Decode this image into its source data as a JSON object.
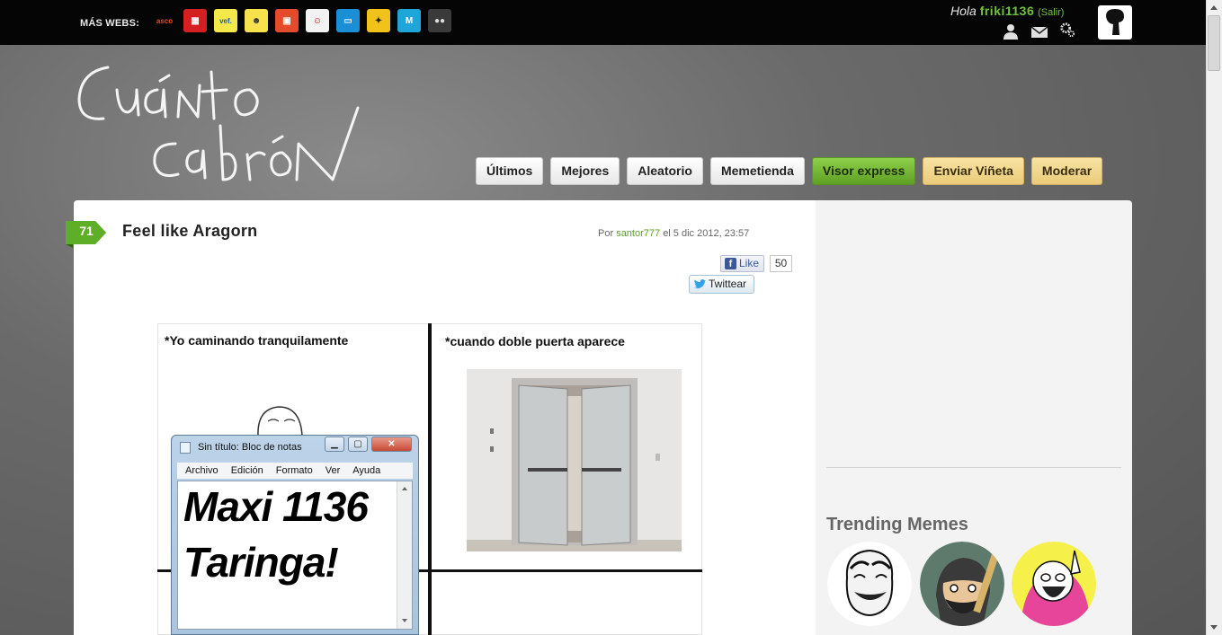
{
  "topbar": {
    "mas_webs_label": "MÁS WEBS:",
    "sites": [
      {
        "icon": "asco-de-vida-icon",
        "glyph": "asco",
        "bg": "#050505",
        "color": "#e84c1a"
      },
      {
        "icon": "calendar-site-icon",
        "glyph": "▦",
        "bg": "#d42020",
        "color": "#fff"
      },
      {
        "icon": "vef-icon",
        "glyph": "vef.",
        "bg": "#f5e84a",
        "color": "#1a5bb5"
      },
      {
        "icon": "banana-icon",
        "glyph": "☻",
        "bg": "#f7e24d",
        "color": "#333"
      },
      {
        "icon": "picture-site-icon",
        "glyph": "▣",
        "bg": "#e34b2a",
        "color": "#fff"
      },
      {
        "icon": "meme-face-icon",
        "glyph": "☺",
        "bg": "#f2f2f2",
        "color": "#c00"
      },
      {
        "icon": "tv-site-icon",
        "glyph": "▭",
        "bg": "#1a8fd6",
        "color": "#fff"
      },
      {
        "icon": "cat-site-icon",
        "glyph": "✦",
        "bg": "#f1c21a",
        "color": "#222"
      },
      {
        "icon": "m-site-icon",
        "glyph": "M",
        "bg": "#1ea6d8",
        "color": "#fff"
      },
      {
        "icon": "eyes-site-icon",
        "glyph": "●●",
        "bg": "#3a3a3a",
        "color": "#ddd"
      }
    ],
    "hola": "Hola",
    "username": "friki1136",
    "salir": "(Salir)"
  },
  "nav": {
    "items": [
      {
        "label": "Últimos",
        "style": "white"
      },
      {
        "label": "Mejores",
        "style": "white"
      },
      {
        "label": "Aleatorio",
        "style": "white"
      },
      {
        "label": "Memetienda",
        "style": "white"
      },
      {
        "label": "Visor express",
        "style": "green"
      },
      {
        "label": "Enviar Viñeta",
        "style": "yellow"
      },
      {
        "label": "Moderar",
        "style": "yellow"
      }
    ]
  },
  "post": {
    "score": "71",
    "title": "Feel like Aragorn",
    "by_prefix": "Por",
    "author": "santor777",
    "date": "el 5 dic 2012, 23:57",
    "like_label": "Like",
    "like_count": "50",
    "tweet_label": "Twittear"
  },
  "comic": {
    "panel1_text": "*Yo caminando tranquilamente",
    "panel2_text": "*cuando doble puerta aparece"
  },
  "notepad": {
    "title": "Sin título: Bloc de notas",
    "menu": [
      "Archivo",
      "Edición",
      "Formato",
      "Ver",
      "Ayuda"
    ],
    "line1": "Maxi 1136",
    "line2": "Taringa!",
    "min": "▁",
    "max": "▢",
    "close": "✕"
  },
  "sidebar": {
    "trending_title": "Trending Memes"
  }
}
